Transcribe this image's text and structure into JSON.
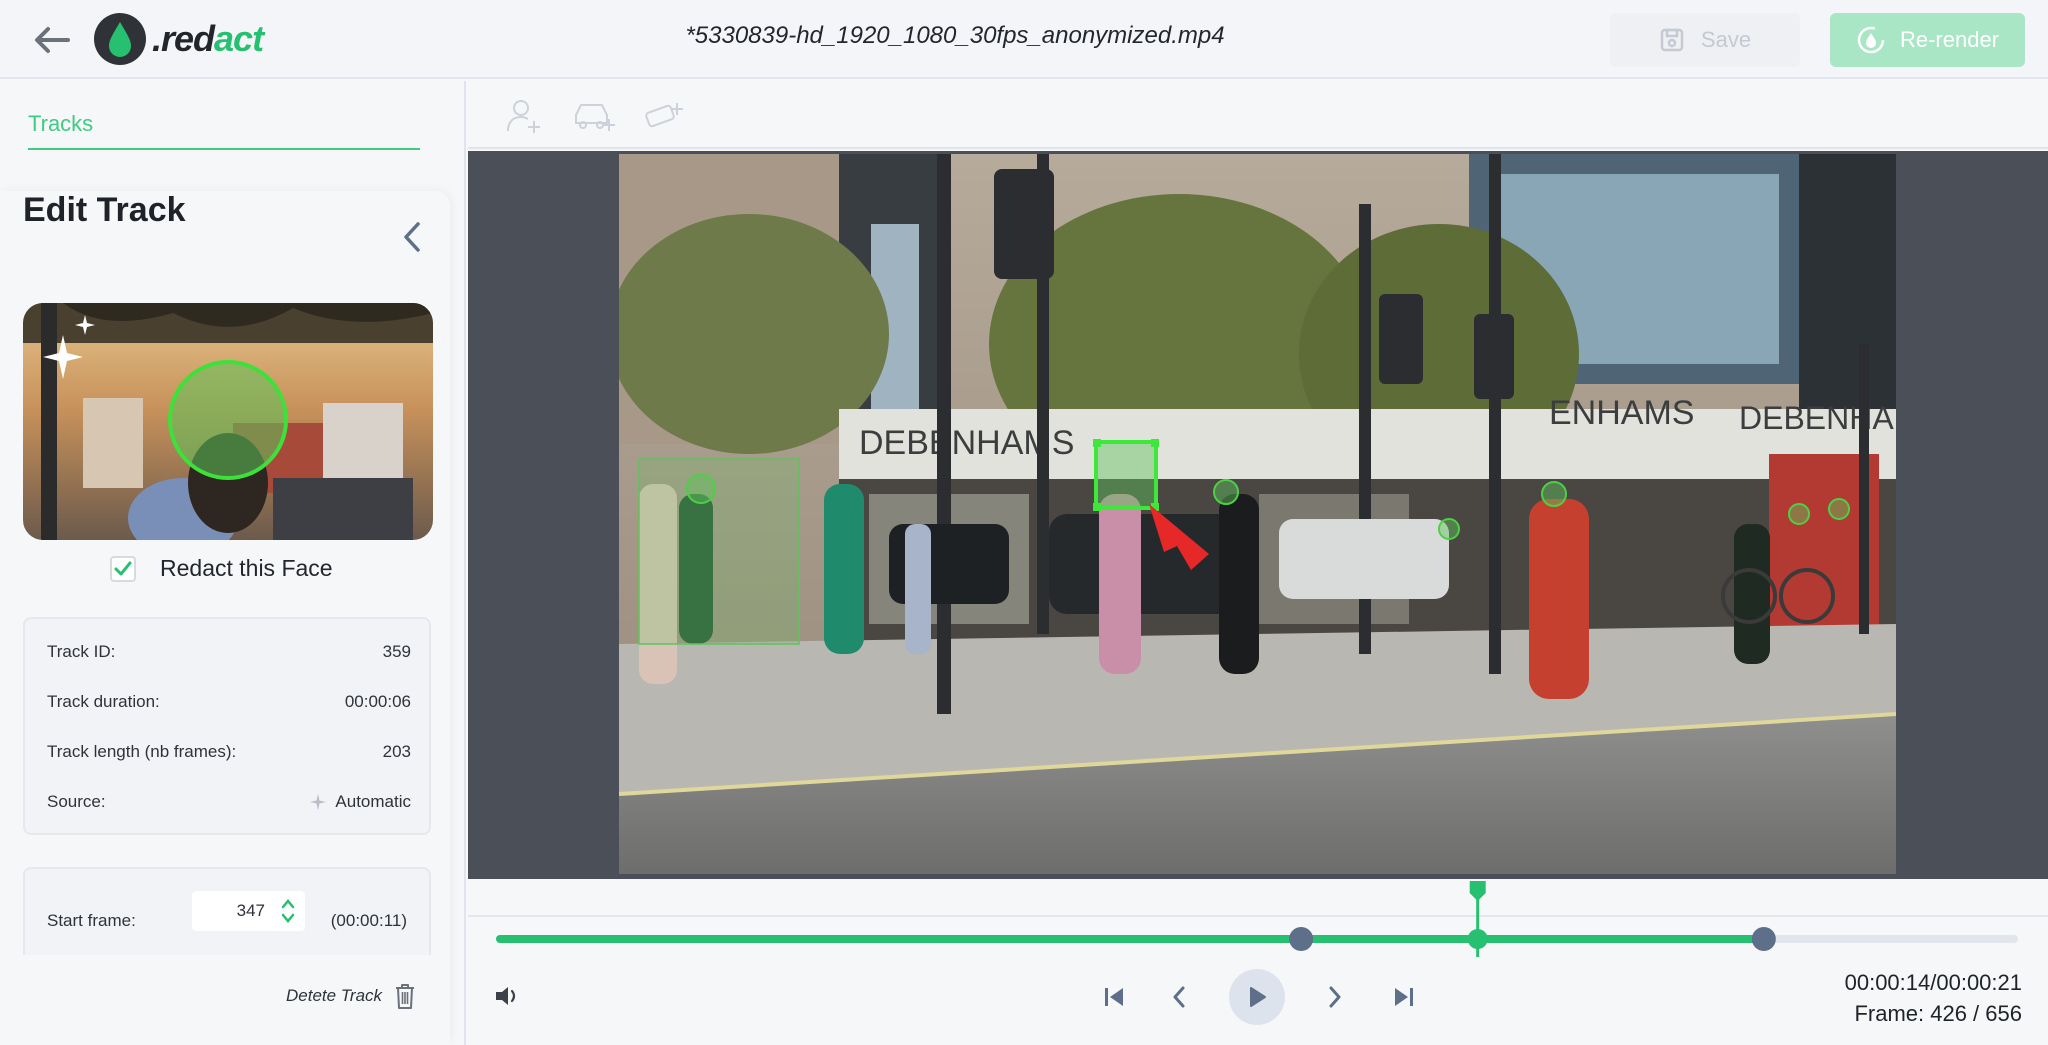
{
  "header": {
    "back_icon": "arrow-left-icon",
    "logo_text_prefix": ".red",
    "logo_text_accent": "act",
    "file_name": "*5330839-hd_1920_1080_30fps_anonymized.mp4",
    "save_label": "Save",
    "rerender_label": "Re-render"
  },
  "sidebar": {
    "tab_label": "Tracks",
    "edit_title": "Edit Track",
    "redact_label": "Redact this Face",
    "redact_checked": true,
    "info": [
      {
        "label": "Track ID:",
        "value": "359"
      },
      {
        "label": "Track duration:",
        "value": "00:00:06"
      },
      {
        "label": "Track length (nb frames):",
        "value": "203"
      },
      {
        "label": "Source:",
        "value": "Automatic"
      }
    ],
    "start_frame_label": "Start frame:",
    "start_frame_value": "347",
    "start_frame_time": "(00:00:11)",
    "delete_label": "Detete Track"
  },
  "toolbar": {
    "tools": [
      "add-person-icon",
      "add-vehicle-icon",
      "add-plate-icon"
    ]
  },
  "video": {
    "storefront_text": [
      "DEBENHAMS",
      "ENHAMS",
      "DEBENHAM"
    ]
  },
  "timeline": {
    "progress_fraction": 0.645,
    "track_start_fraction": 0.529,
    "track_end_fraction": 0.833
  },
  "playback": {
    "time": "00:00:14/00:00:21",
    "frame": "Frame: 426 / 656"
  },
  "colors": {
    "accent": "#27bf70",
    "accent_light": "#a8e6c6",
    "video_bg": "#4b5058"
  }
}
